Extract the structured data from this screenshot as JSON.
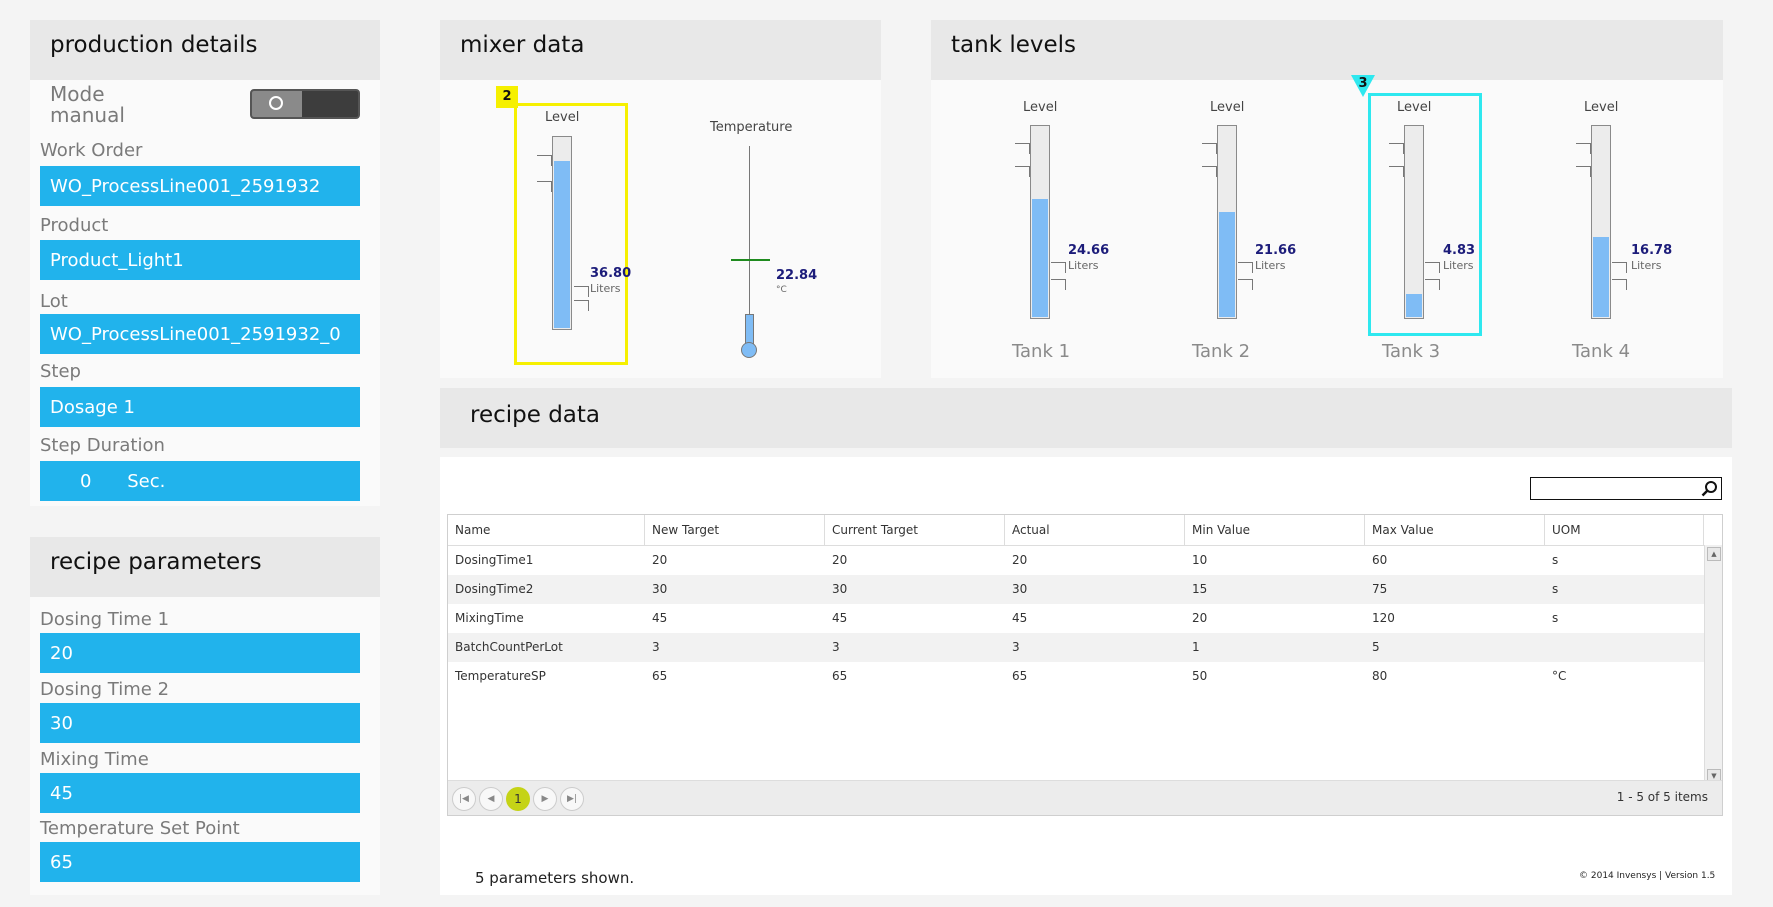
{
  "production": {
    "title": "production details",
    "mode_label": "Mode",
    "mode_value": "manual",
    "work_order_label": "Work Order",
    "work_order": "WO_ProcessLine001_2591932",
    "product_label": "Product",
    "product": "Product_Light1",
    "lot_label": "Lot",
    "lot": "WO_ProcessLine001_2591932_0",
    "step_label": "Step",
    "step": "Dosage 1",
    "duration_label": "Step Duration",
    "duration_value": "0",
    "duration_unit": "Sec."
  },
  "recipe_params": {
    "title": "recipe parameters",
    "items": [
      {
        "label": "Dosing Time 1",
        "value": "20"
      },
      {
        "label": "Dosing Time 2",
        "value": "30"
      },
      {
        "label": "Mixing Time",
        "value": "45"
      },
      {
        "label": "Temperature Set Point",
        "value": "65"
      }
    ]
  },
  "mixer": {
    "title": "mixer data",
    "badge": "2",
    "level_label": "Level",
    "level_value": "36.80",
    "level_fraction": 0.88,
    "level_unit": "Liters",
    "temp_label": "Temperature",
    "temp_value": "22.84",
    "temp_unit": "°C",
    "accent": "#f6f000"
  },
  "tanks": {
    "title": "tank levels",
    "badge": "3",
    "accent": "#2ee8ef",
    "items": [
      {
        "level_label": "Level",
        "value": "24.66",
        "unit": "Liters",
        "fraction": 0.62,
        "name": "Tank 1"
      },
      {
        "level_label": "Level",
        "value": "21.66",
        "unit": "Liters",
        "fraction": 0.55,
        "name": "Tank 2"
      },
      {
        "level_label": "Level",
        "value": "4.83",
        "unit": "Liters",
        "fraction": 0.12,
        "name": "Tank 3"
      },
      {
        "level_label": "Level",
        "value": "16.78",
        "unit": "Liters",
        "fraction": 0.42,
        "name": "Tank 4"
      }
    ]
  },
  "recipe_data": {
    "title": "recipe data",
    "columns": [
      "Name",
      "New Target",
      "Current Target",
      "Actual",
      "Min Value",
      "Max Value",
      "UOM"
    ],
    "rows": [
      [
        "DosingTime1",
        "20",
        "20",
        "20",
        "10",
        "60",
        "s"
      ],
      [
        "DosingTime2",
        "30",
        "30",
        "30",
        "15",
        "75",
        "s"
      ],
      [
        "MixingTime",
        "45",
        "45",
        "45",
        "20",
        "120",
        "s"
      ],
      [
        "BatchCountPerLot",
        "3",
        "3",
        "3",
        "1",
        "5",
        ""
      ],
      [
        "TemperatureSP",
        "65",
        "65",
        "65",
        "50",
        "80",
        "°C"
      ]
    ],
    "current_page": "1",
    "items_info": "1 - 5 of 5 items",
    "footer": "5 parameters shown.",
    "copyright": "© 2014 Invensys | Version 1.5"
  }
}
